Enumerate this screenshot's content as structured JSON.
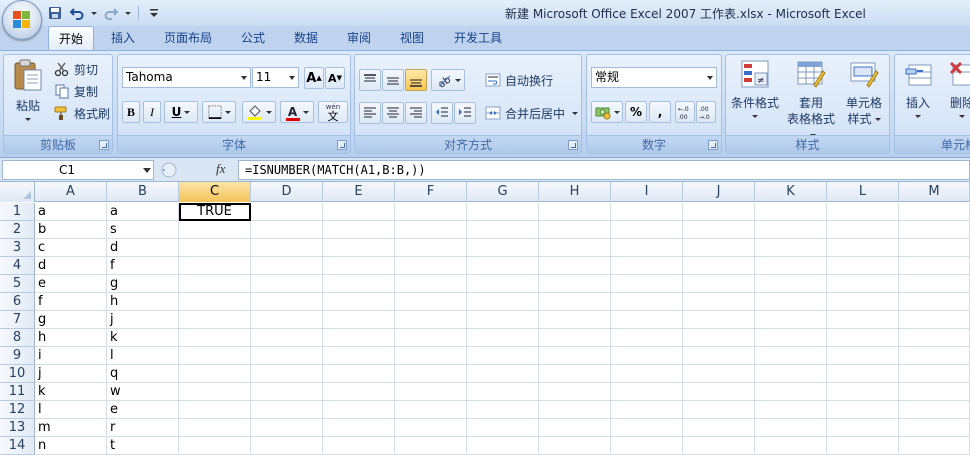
{
  "window": {
    "title": "新建 Microsoft Office Excel 2007 工作表.xlsx - Microsoft Excel"
  },
  "qat": {
    "items": [
      "save-icon",
      "undo-icon",
      "redo-icon",
      "customize-icon"
    ]
  },
  "tabs": [
    {
      "label": "开始",
      "active": true
    },
    {
      "label": "插入"
    },
    {
      "label": "页面布局"
    },
    {
      "label": "公式"
    },
    {
      "label": "数据"
    },
    {
      "label": "审阅"
    },
    {
      "label": "视图"
    },
    {
      "label": "开发工具"
    }
  ],
  "ribbon": {
    "clipboard": {
      "label": "剪贴板",
      "paste": "粘贴",
      "cut": "剪切",
      "copy": "复制",
      "format_painter": "格式刷"
    },
    "font": {
      "label": "字体",
      "font_name": "Tahoma",
      "font_size": "11",
      "bold": "B",
      "italic": "I",
      "underline": "U",
      "grow": "A",
      "shrink": "A",
      "font_color_letter": "A",
      "phonetic_top": "wén",
      "phonetic_bottom": "文"
    },
    "alignment": {
      "label": "对齐方式",
      "wrap_text": "自动换行",
      "merge_center": "合并后居中"
    },
    "number": {
      "label": "数字",
      "format": "常规",
      "percent": "%",
      "comma": ","
    },
    "styles": {
      "label": "样式",
      "conditional": "条件格式",
      "table_line1": "套用",
      "table_line2": "表格格式",
      "cell_styles_line1": "单元格",
      "cell_styles_line2": "样式"
    },
    "cells": {
      "label": "单元格",
      "insert": "插入",
      "delete": "删除"
    }
  },
  "formula_bar": {
    "name_box": "C1",
    "fx": "fx",
    "formula": "=ISNUMBER(MATCH(A1,B:B,))"
  },
  "grid": {
    "columns": [
      "A",
      "B",
      "C",
      "D",
      "E",
      "F",
      "G",
      "H",
      "I",
      "J",
      "K",
      "L",
      "M"
    ],
    "active_column": "C",
    "rows": [
      {
        "n": "1",
        "A": "a",
        "B": "a",
        "C": "TRUE"
      },
      {
        "n": "2",
        "A": "b",
        "B": "s",
        "C": ""
      },
      {
        "n": "3",
        "A": "c",
        "B": "d",
        "C": ""
      },
      {
        "n": "4",
        "A": "d",
        "B": "f",
        "C": ""
      },
      {
        "n": "5",
        "A": "e",
        "B": "g",
        "C": ""
      },
      {
        "n": "6",
        "A": "f",
        "B": "h",
        "C": ""
      },
      {
        "n": "7",
        "A": "g",
        "B": "j",
        "C": ""
      },
      {
        "n": "8",
        "A": "h",
        "B": "k",
        "C": ""
      },
      {
        "n": "9",
        "A": "i",
        "B": "l",
        "C": ""
      },
      {
        "n": "10",
        "A": "j",
        "B": "q",
        "C": ""
      },
      {
        "n": "11",
        "A": "k",
        "B": "w",
        "C": ""
      },
      {
        "n": "12",
        "A": "l",
        "B": "e",
        "C": ""
      },
      {
        "n": "13",
        "A": "m",
        "B": "r",
        "C": ""
      },
      {
        "n": "14",
        "A": "n",
        "B": "t",
        "C": ""
      }
    ]
  },
  "colors": {
    "accent": "#15428b",
    "selection_header": "#f5c35a",
    "font_color_bar": "#e00000",
    "highlight_bar": "#ffff00"
  }
}
